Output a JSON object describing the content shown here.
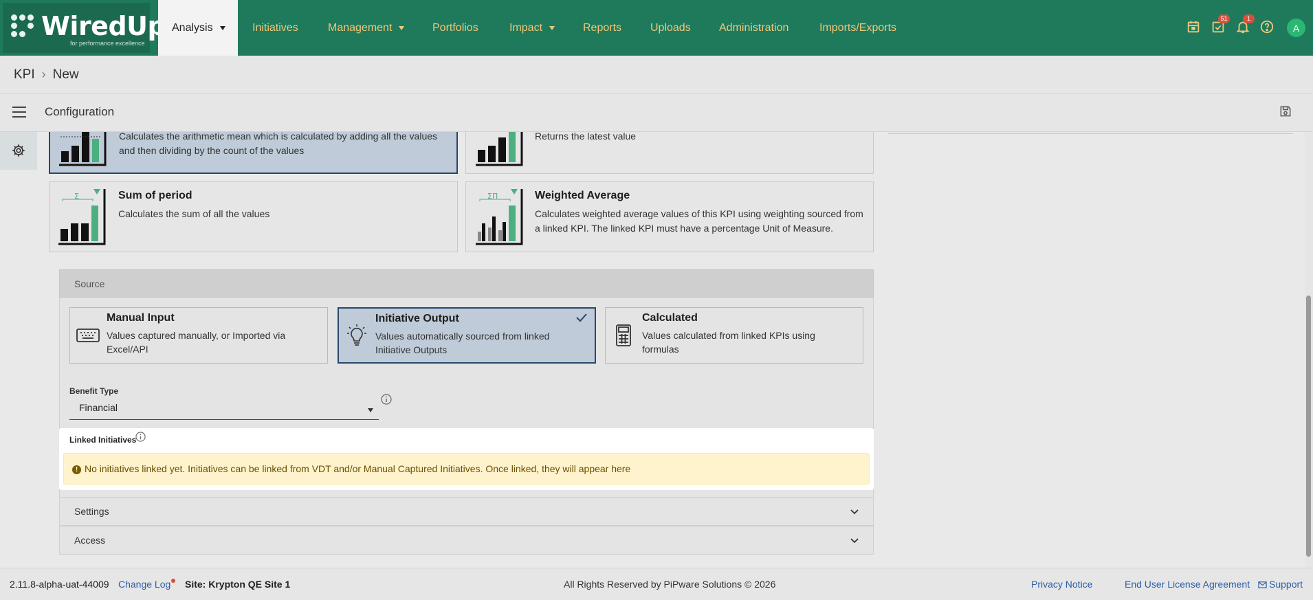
{
  "brand": {
    "name": "WiredUp",
    "tagline": "for performance excellence"
  },
  "nav": {
    "items": [
      {
        "label": "Analysis",
        "active": true,
        "has_dropdown": true
      },
      {
        "label": "Initiatives"
      },
      {
        "label": "Management",
        "has_dropdown": true
      },
      {
        "label": "Portfolios"
      },
      {
        "label": "Impact",
        "has_dropdown": true
      },
      {
        "label": "Reports"
      },
      {
        "label": "Uploads"
      },
      {
        "label": "Administration"
      },
      {
        "label": "Imports/Exports"
      }
    ],
    "icons": {
      "calendar": "calendar-icon",
      "tasks": "task-check-icon",
      "tasks_badge": "51",
      "notifications": "bell-icon",
      "notifications_badge": "1",
      "help": "help-icon"
    },
    "avatar_initial": "A"
  },
  "breadcrumb": {
    "root": "KPI",
    "current": "New"
  },
  "config": {
    "title": "Configuration"
  },
  "aggregation": {
    "average_desc": "Calculates the arithmetic mean which is calculated by adding all the values and then dividing by the count of the values",
    "latest_desc": "Returns the latest value",
    "sum": {
      "title": "Sum of period",
      "desc": "Calculates the sum of all the values",
      "symbol": "Σ"
    },
    "weighted": {
      "title": "Weighted Average",
      "desc": "Calculates weighted average values of this KPI using weighting sourced from a linked KPI. The linked KPI must have a percentage Unit of Measure.",
      "symbol": "ΣΠ"
    }
  },
  "source": {
    "heading": "Source",
    "options": [
      {
        "title": "Manual Input",
        "desc": "Values captured manually, or Imported via Excel/API",
        "icon": "keyboard-icon"
      },
      {
        "title": "Initiative Output",
        "desc": "Values automatically sourced from linked Initiative Outputs",
        "icon": "lightbulb-icon",
        "selected": true
      },
      {
        "title": "Calculated",
        "desc": "Values calculated from linked KPIs using formulas",
        "icon": "calculator-icon"
      }
    ],
    "benefit_type": {
      "label": "Benefit Type",
      "value": "Financial"
    },
    "linked": {
      "label": "Linked Initiatives",
      "message": "No initiatives linked yet. Initiatives can be linked from VDT and/or Manual Captured Initiatives. Once linked, they will appear here"
    },
    "settings_label": "Settings",
    "access_label": "Access"
  },
  "footer": {
    "version": "2.11.8-alpha-uat-44009",
    "change_log": "Change Log",
    "site": "Site: Krypton QE Site 1",
    "rights": "All Rights Reserved by PiPware Solutions © 2026",
    "privacy": "Privacy Notice",
    "eula": "End User License Agreement",
    "support": "Support"
  },
  "colors": {
    "nav_bg": "#1f7a5c",
    "nav_text": "#f0c77a",
    "selected_card": "#bfcbd8",
    "selected_border": "#27476b",
    "alert_bg": "#fff3cd",
    "bar_accent": "#4caf7f"
  }
}
